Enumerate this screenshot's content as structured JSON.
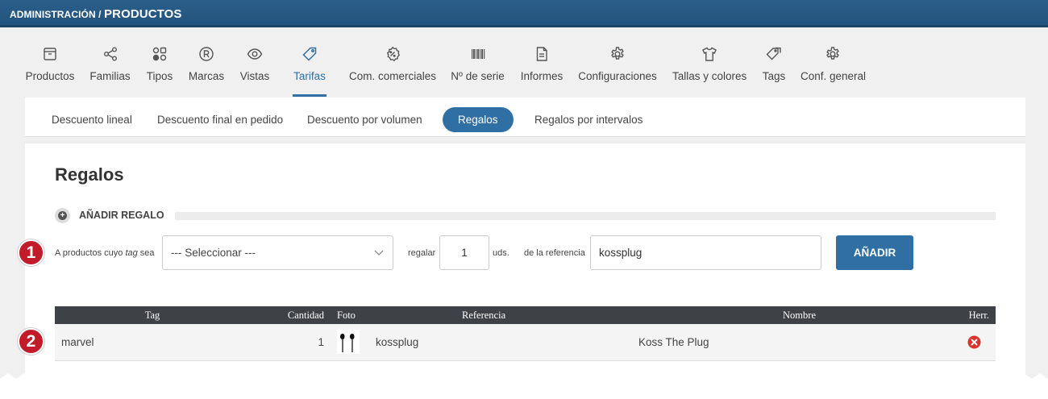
{
  "header": {
    "breadcrumb_prefix": "ADMINISTRACIÓN / ",
    "breadcrumb_current": "PRODUCTOS"
  },
  "nav": {
    "items": [
      {
        "label": "Productos",
        "icon": "box-icon"
      },
      {
        "label": "Familias",
        "icon": "share-icon"
      },
      {
        "label": "Tipos",
        "icon": "shapes-icon"
      },
      {
        "label": "Marcas",
        "icon": "registered-icon"
      },
      {
        "label": "Vistas",
        "icon": "eye-icon"
      },
      {
        "label": "Tarifas",
        "icon": "tag-icon"
      },
      {
        "label": "Com. comerciales",
        "icon": "percent-badge-icon"
      },
      {
        "label": "Nº de serie",
        "icon": "barcode-icon"
      },
      {
        "label": "Informes",
        "icon": "document-icon"
      },
      {
        "label": "Configuraciones",
        "icon": "gear-icon"
      },
      {
        "label": "Tallas y colores",
        "icon": "tshirt-icon"
      },
      {
        "label": "Tags",
        "icon": "tags-icon"
      },
      {
        "label": "Conf. general",
        "icon": "gear-icon"
      }
    ],
    "active": "Tarifas"
  },
  "subtabs": {
    "items": [
      "Descuento lineal",
      "Descuento final en pedido",
      "Descuento por volumen",
      "Regalos",
      "Regalos por intervalos"
    ],
    "active": "Regalos"
  },
  "panel": {
    "title": "Regalos",
    "section_title": "AÑADIR REGALO",
    "form": {
      "label_tag_prefix": "A productos cuyo ",
      "label_tag_em": "tag",
      "label_tag_suffix": " sea",
      "select_value": "--- Seleccionar ---",
      "label_regalar": "regalar",
      "quantity_value": "1",
      "label_uds": "uds.",
      "label_referencia": "de la referencia",
      "referencia_value": "kossplug",
      "add_button": "AÑADIR"
    },
    "table": {
      "headers": [
        "Tag",
        "Cantidad",
        "Foto",
        "Referencia",
        "Nombre",
        "Herr."
      ],
      "rows": [
        {
          "tag": "marvel",
          "cantidad": "1",
          "referencia": "kossplug",
          "nombre": "Koss The Plug"
        }
      ]
    }
  },
  "badges": [
    "1",
    "2"
  ],
  "colors": {
    "accent": "#2f6fa3",
    "badge": "#c21b2a",
    "delete": "#d9332e",
    "header_bg": "#22537d"
  }
}
